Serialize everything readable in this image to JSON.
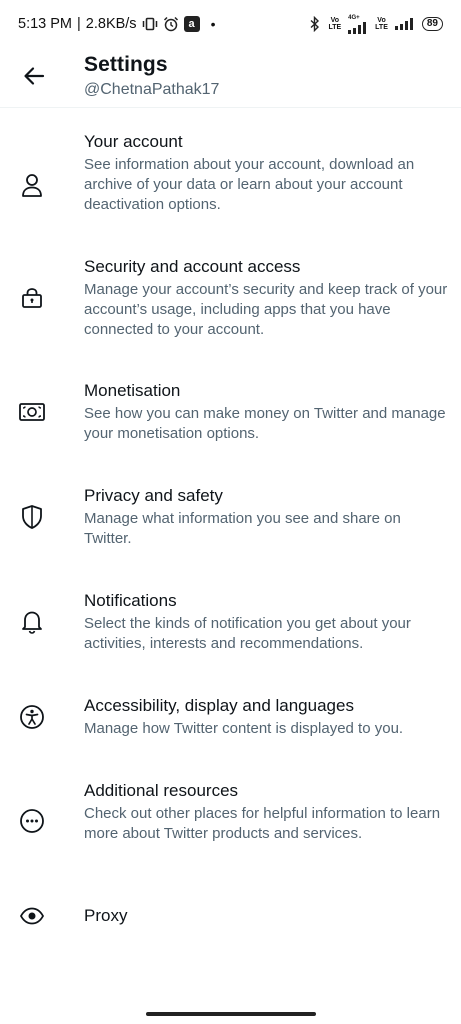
{
  "status_bar": {
    "time": "5:13 PM",
    "separator": "|",
    "speed": "2.8KB/s",
    "app_badge": "a",
    "dot": "•",
    "net1_top": "Vo",
    "net1_bottom": "LTE",
    "net_4g": "4G+",
    "net2_top": "Vo",
    "net2_bottom": "LTE",
    "battery": "89",
    "icons": [
      "vibrate-icon",
      "alarm-icon",
      "bluetooth-icon",
      "signal-icon",
      "battery-icon"
    ]
  },
  "header": {
    "back_icon": "arrow-left-icon",
    "title": "Settings",
    "handle": "@ChetnaPathak17"
  },
  "settings": {
    "items": [
      {
        "icon": "person-icon",
        "title": "Your account",
        "description": "See information about your account, download an archive of your data or learn about your account deactivation options."
      },
      {
        "icon": "lock-icon",
        "title": "Security and account access",
        "description": "Manage your account’s security and keep track of your account’s usage, including apps that you have connected to your account."
      },
      {
        "icon": "money-icon",
        "title": "Monetisation",
        "description": "See how you can make money on Twitter and manage your monetisation options."
      },
      {
        "icon": "shield-icon",
        "title": "Privacy and safety",
        "description": "Manage what information you see and share on Twitter."
      },
      {
        "icon": "bell-icon",
        "title": "Notifications",
        "description": "Select the kinds of notification you get about your activities, interests and recommendations."
      },
      {
        "icon": "accessibility-icon",
        "title": "Accessibility, display and languages",
        "description": "Manage how Twitter content is displayed to you."
      },
      {
        "icon": "more-circle-icon",
        "title": "Additional resources",
        "description": "Check out other places for helpful information to learn more about Twitter products and services."
      },
      {
        "icon": "eye-icon",
        "title": "Proxy",
        "description": ""
      }
    ]
  },
  "colors": {
    "primary_text": "#0f1419",
    "secondary_text": "#536471",
    "background": "#ffffff"
  }
}
